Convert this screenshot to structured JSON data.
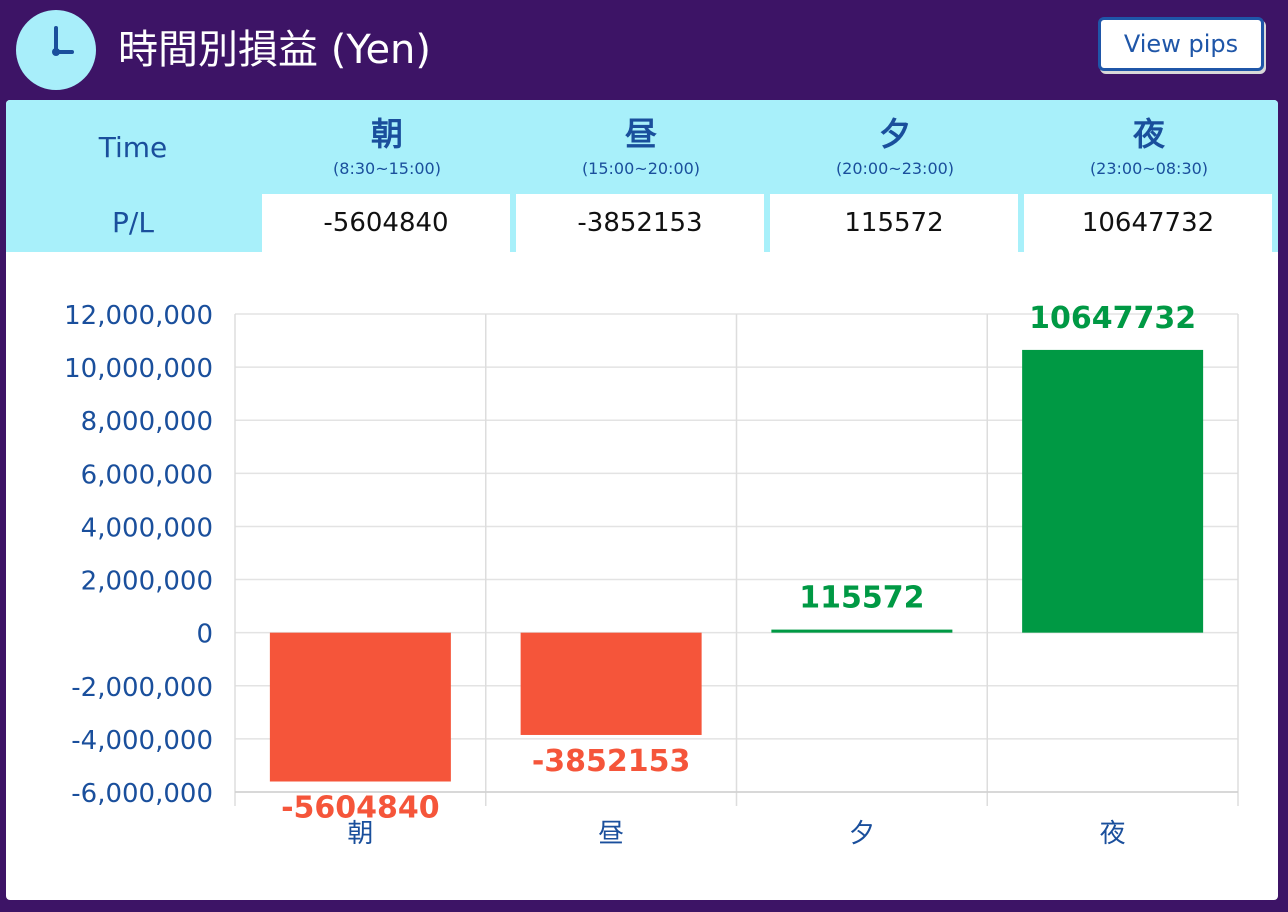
{
  "header": {
    "title": "時間別損益 (Yen)",
    "icon": "clock-icon",
    "view_pips_label": "View pips"
  },
  "table": {
    "time_label": "Time",
    "pl_label": "P/L",
    "columns": [
      {
        "name": "朝",
        "range": "(8:30~15:00)",
        "pl": "-5604840"
      },
      {
        "name": "昼",
        "range": "(15:00~20:00)",
        "pl": "-3852153"
      },
      {
        "name": "夕",
        "range": "(20:00~23:00)",
        "pl": "115572"
      },
      {
        "name": "夜",
        "range": "(23:00~08:30)",
        "pl": "10647732"
      }
    ]
  },
  "colors": {
    "background": "#3d1466",
    "accent_light": "#a8f0fa",
    "label_blue": "#1a4f9c",
    "negative": "#f5553a",
    "positive": "#009944"
  },
  "chart_data": {
    "type": "bar",
    "categories": [
      "朝",
      "昼",
      "夕",
      "夜"
    ],
    "values": [
      -5604840,
      -3852153,
      115572,
      10647732
    ],
    "data_labels": [
      "-5604840",
      "-3852153",
      "115572",
      "10647732"
    ],
    "yticks": [
      "12,000,000",
      "10,000,000",
      "8,000,000",
      "6,000,000",
      "4,000,000",
      "2,000,000",
      "0",
      "-2,000,000",
      "-4,000,000",
      "-6,000,000"
    ],
    "ytick_values": [
      12000000,
      10000000,
      8000000,
      6000000,
      4000000,
      2000000,
      0,
      -2000000,
      -4000000,
      -6000000
    ],
    "ylim": [
      -6000000,
      12000000
    ],
    "grid": true,
    "legend": false
  }
}
